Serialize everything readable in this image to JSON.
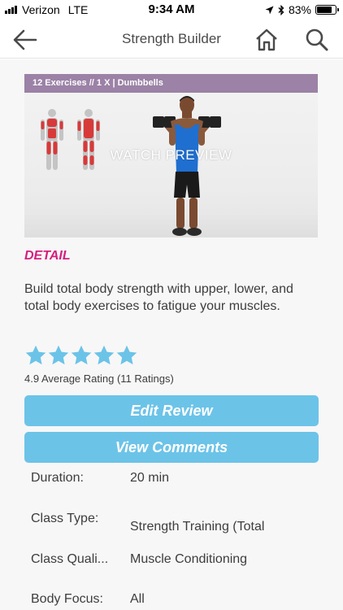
{
  "status_bar": {
    "carrier": "Verizon",
    "network": "LTE",
    "time": "9:34 AM",
    "battery": "83%",
    "battery_level": 0.83
  },
  "nav": {
    "title": "Strength Builder",
    "icons": [
      "back-arrow-icon",
      "home-icon",
      "search-icon"
    ]
  },
  "preview": {
    "banner": "12 Exercises // 1 X | Dumbbells",
    "watch_label": "WATCH PREVIEW",
    "banner_color": "#9b82a6"
  },
  "detail": {
    "heading": "DETAIL",
    "description": "Build total body strength with upper, lower, and total body exercises to fatigue your muscles.",
    "stars": 5,
    "rating_text": "4.9 Average Rating (11 Ratings)"
  },
  "buttons": {
    "edit_review": "Edit Review",
    "view_comments": "View Comments",
    "color": "#6cc3e8"
  },
  "info": [
    {
      "label": "Duration:",
      "value": "20 min"
    },
    {
      "label": "Class Type:",
      "value": "Strength Training (Total"
    },
    {
      "label": "Class Quali...",
      "value": "Muscle Conditioning"
    },
    {
      "label": "Body Focus:",
      "value": "All"
    }
  ],
  "colors": {
    "accent_pink": "#d61f7f",
    "star_blue": "#6cc3e8"
  }
}
